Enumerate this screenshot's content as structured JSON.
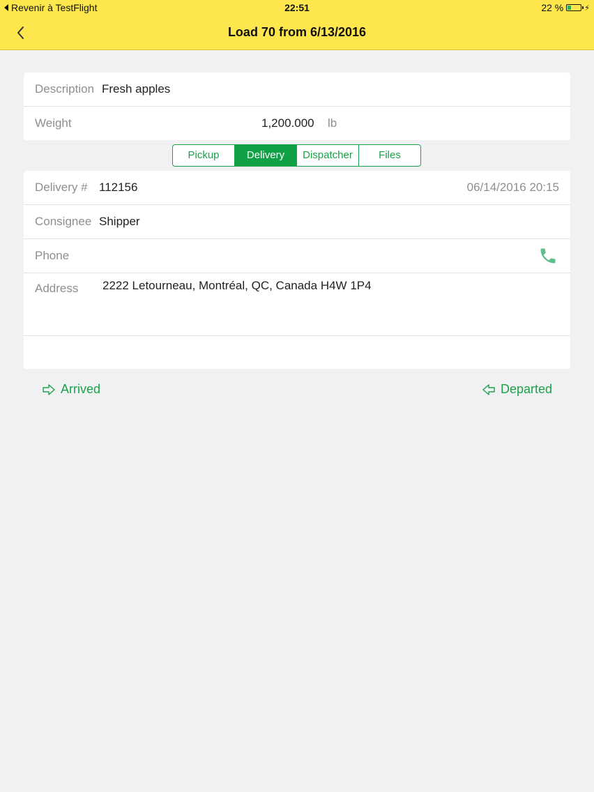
{
  "status_bar": {
    "back_app": "Revenir à TestFlight",
    "time": "22:51",
    "battery": "22 %"
  },
  "nav": {
    "title": "Load 70 from 6/13/2016",
    "back_icon": "chevron-left-icon"
  },
  "load": {
    "description_label": "Description",
    "description_value": "Fresh apples",
    "weight_label": "Weight",
    "weight_value": "1,200.000",
    "weight_unit": "lb"
  },
  "tabs": [
    {
      "label": "Pickup",
      "active": false
    },
    {
      "label": "Delivery",
      "active": true
    },
    {
      "label": "Dispatcher",
      "active": false
    },
    {
      "label": "Files",
      "active": false
    }
  ],
  "delivery": {
    "number_label": "Delivery #",
    "number_value": "112156",
    "datetime": "06/14/2016 20:15",
    "consignee_label": "Consignee",
    "consignee_value": "Shipper",
    "phone_label": "Phone",
    "address_label": "Address",
    "address_value": "2222 Letourneau, Montréal, QC, Canada H4W 1P4"
  },
  "actions": {
    "arrived": "Arrived",
    "departed": "Departed"
  },
  "colors": {
    "header": "#fde74c",
    "accent": "#10a046",
    "background": "#f1f1f3"
  }
}
